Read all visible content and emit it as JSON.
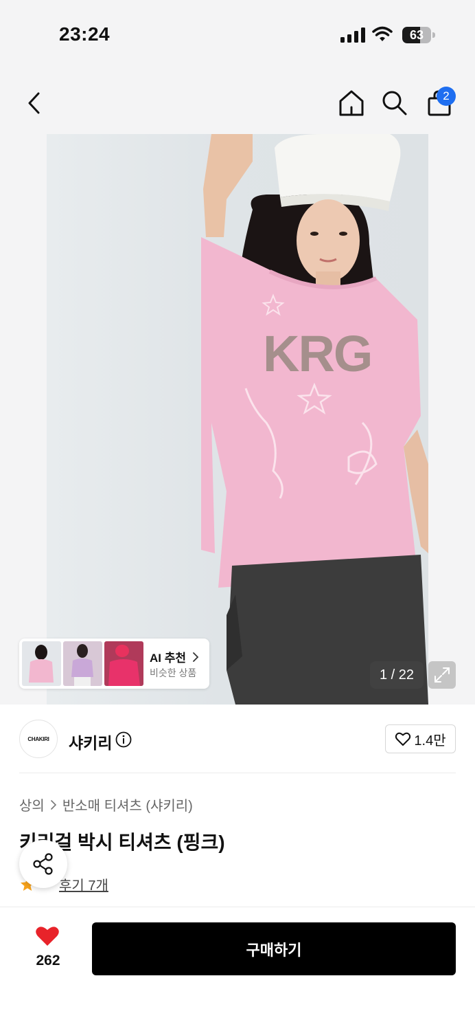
{
  "status_bar": {
    "time": "23:24",
    "battery": "63",
    "battery_level_pct": 63
  },
  "nav": {
    "back_icon": "chevron-left-icon",
    "home_icon": "home-icon",
    "search_icon": "search-icon",
    "cart_icon": "shopping-bag-icon",
    "cart_count": "2"
  },
  "gallery": {
    "counter": "1 / 22",
    "expand_icon": "expand-icon",
    "ai_recommend": {
      "title": "AI 추천",
      "subtitle": "비슷한 상품",
      "thumbnail_count": 3
    }
  },
  "brand": {
    "name": "샤키리",
    "logo_text": "CHAKIRI",
    "likes": "1.4만"
  },
  "product": {
    "breadcrumb": [
      "상의",
      "반소매 티셔츠 (샤키리)"
    ],
    "title": "키리걸 박시 티셔츠 (핑크)",
    "review_label": "후기 7개"
  },
  "bottom_bar": {
    "wish_count": "262",
    "buy_label": "구매하기"
  },
  "colors": {
    "accent_blue": "#1e6ef0",
    "heart_red": "#e8232a",
    "star_orange": "#f7a21b",
    "buy_button": "#000000",
    "shirt_pink": "#f2b7cf"
  }
}
